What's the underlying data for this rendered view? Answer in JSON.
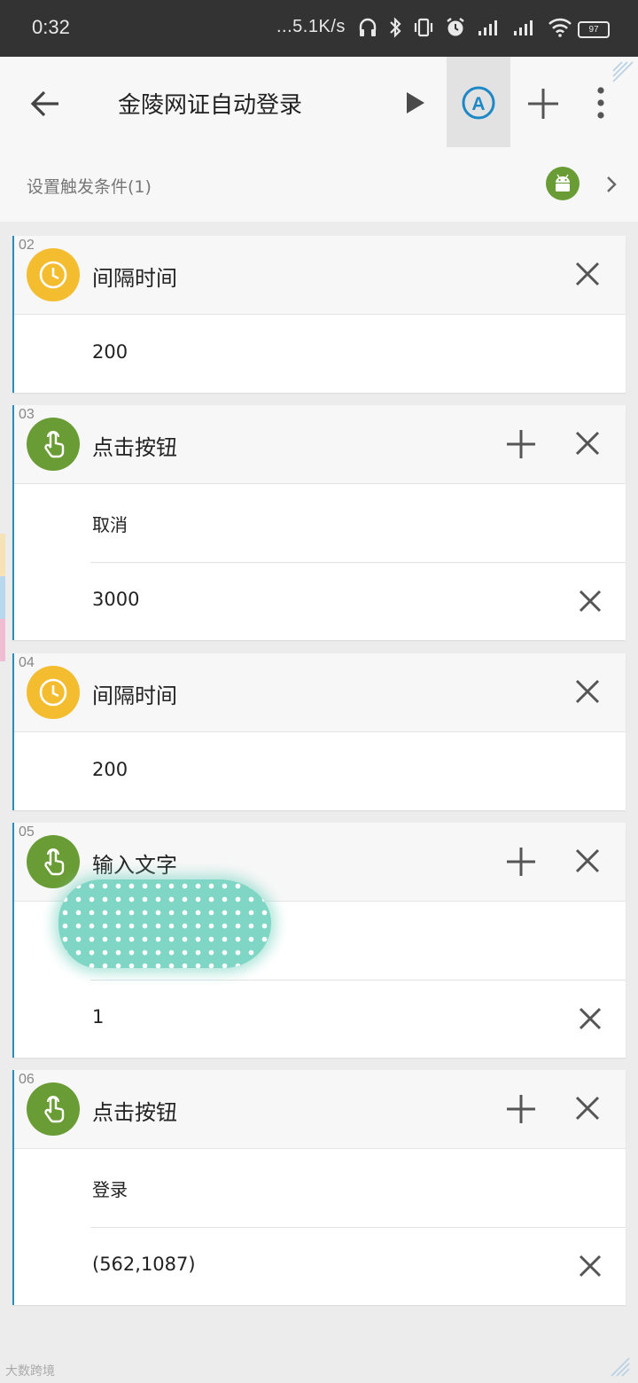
{
  "status_bar": {
    "time": "0:32",
    "net_speed": "...5.1K/s",
    "battery": "97"
  },
  "app_bar": {
    "title": "金陵网证自动登录",
    "auto_icon_letter": "A"
  },
  "trigger": {
    "label": "设置触发条件(1)"
  },
  "steps": [
    {
      "num": "02",
      "title": "间隔时间",
      "icon": "clock-icon",
      "rows": [
        "200"
      ]
    },
    {
      "num": "03",
      "title": "点击按钮",
      "icon": "touch-icon",
      "rows": [
        "取消",
        "3000"
      ]
    },
    {
      "num": "04",
      "title": "间隔时间",
      "icon": "clock-icon",
      "rows": [
        "200"
      ]
    },
    {
      "num": "05",
      "title": "输入文字",
      "icon": "touch-icon",
      "rows": [
        "",
        "1"
      ]
    },
    {
      "num": "06",
      "title": "点击按钮",
      "icon": "touch-icon",
      "rows": [
        "登录",
        "(562,1087)"
      ]
    }
  ],
  "colors": {
    "accent_blue": "#1e88c7",
    "clock_badge": "#f3bd2f",
    "touch_badge": "#6a9c35",
    "left_tabs": [
      "#f5e3b5",
      "#b8d8ee",
      "#f0bcd2"
    ]
  },
  "watermark": "大数跨境"
}
